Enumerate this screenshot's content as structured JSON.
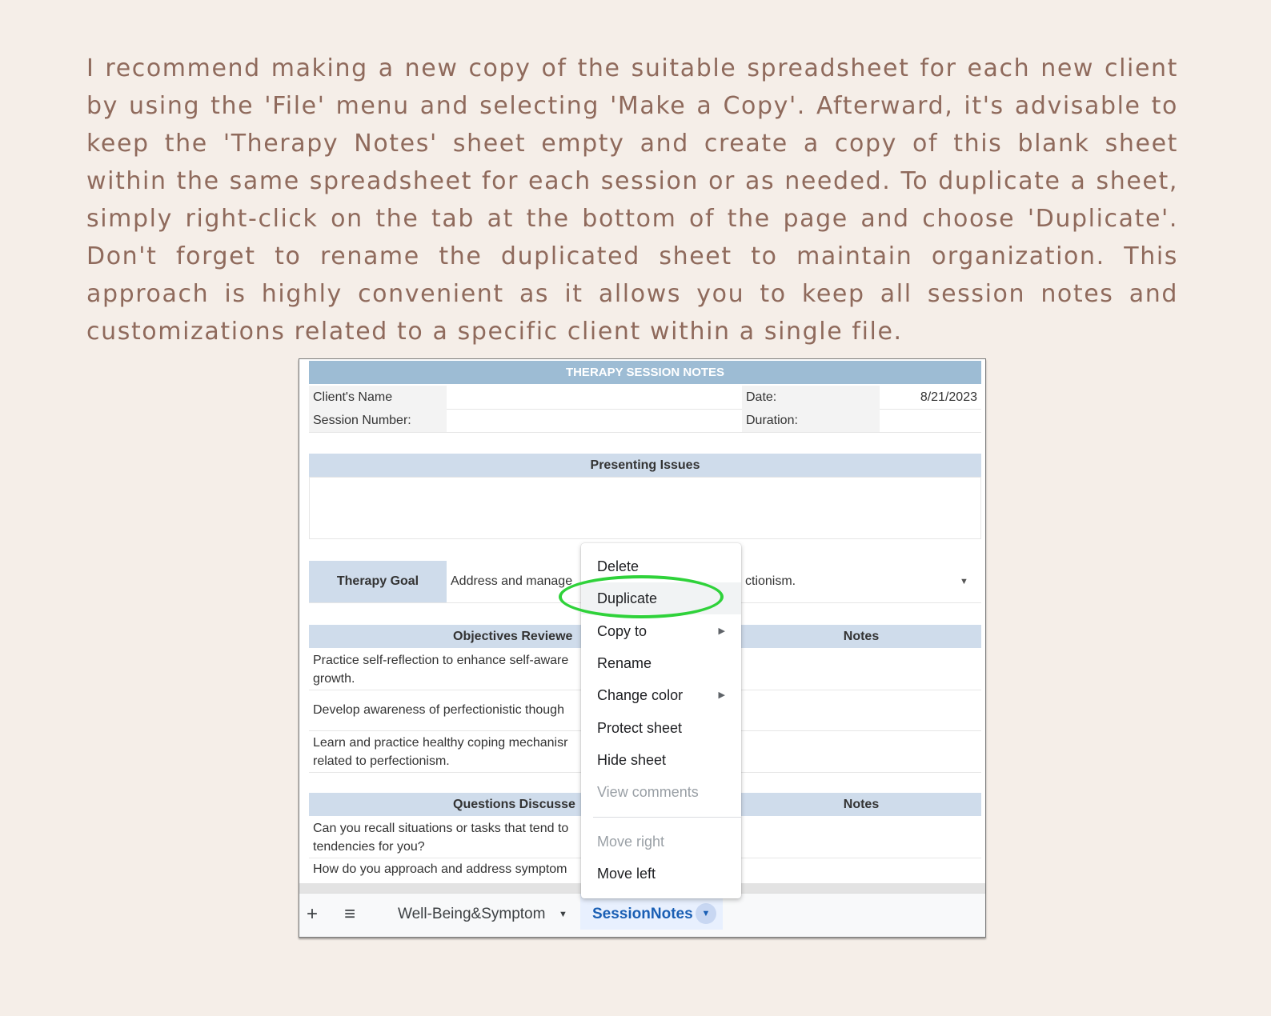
{
  "intro_text": "I recommend making a new copy of the suitable spreadsheet for each new client by using the 'File' menu and selecting 'Make a Copy'. Afterward, it's advisable to keep the 'Therapy Notes' sheet empty and create a copy of this blank sheet within the same spreadsheet for each session or as needed. To duplicate a sheet, simply right-click on the tab at the bottom of the page and choose 'Duplicate'. Don't forget to rename the duplicated sheet to maintain organization. This approach is highly convenient as it allows you to keep all session notes and customizations related to a specific client within a single file.",
  "sheet": {
    "title": "THERAPY SESSION NOTES",
    "client_name_label": "Client's Name",
    "date_label": "Date:",
    "date_value": "8/21/2023",
    "session_number_label": "Session Number:",
    "duration_label": "Duration:",
    "presenting_issues_label": "Presenting Issues",
    "therapy_goal_label": "Therapy Goal",
    "therapy_goal_value_left": "Address and manage",
    "therapy_goal_value_right": "ctionism.",
    "objectives_label": "Objectives Reviewe",
    "notes_label": "Notes",
    "objectives": [
      "Practice self-reflection to enhance self-aware growth.",
      "Develop awareness of perfectionistic though",
      "Learn and practice healthy coping mechanisr related to perfectionism."
    ],
    "questions_label": "Questions Discusse",
    "questions": [
      "Can you recall situations or tasks that tend to tendencies for you?",
      "How do you approach and address symptom"
    ]
  },
  "tabs": {
    "add_icon": "+",
    "menu_icon": "≡",
    "tab1_label": "Well-Being&Symptom",
    "tab2_label": "SessionNotes"
  },
  "context_menu": {
    "items": [
      "Delete",
      "Duplicate",
      "Copy to",
      "Rename",
      "Change color",
      "Protect sheet",
      "Hide sheet",
      "View comments",
      "Move right",
      "Move left"
    ]
  },
  "colors": {
    "background": "#f5eee8",
    "text": "#8f6a5c",
    "header_dark": "#9dbcd4",
    "header_light": "#cfdceb",
    "highlight_circle": "#2fd23a",
    "active_tab": "#1a5fb4"
  }
}
